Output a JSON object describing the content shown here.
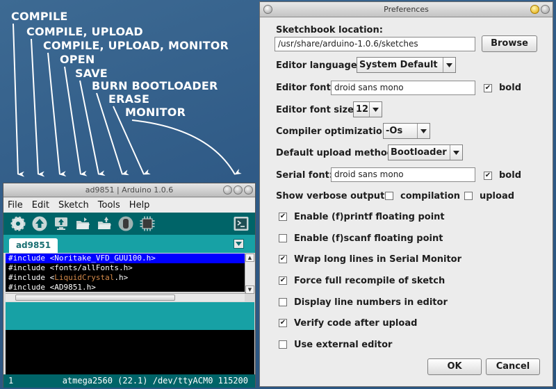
{
  "annotations": {
    "labels": [
      "COMPILE",
      "COMPILE, UPLOAD",
      "COMPILE, UPLOAD, MONITOR",
      "OPEN",
      "SAVE",
      "BURN BOOTLOADER",
      "ERASE",
      "MONITOR"
    ]
  },
  "arduino": {
    "title": "ad9851 | Arduino 1.0.6",
    "menu": [
      "File",
      "Edit",
      "Sketch",
      "Tools",
      "Help"
    ],
    "toolbar_icons": [
      "gear-icon",
      "upload-arrow-icon",
      "upload-monitor-icon",
      "open-folder-icon",
      "save-folder-icon",
      "burn-bootloader-icon",
      "chip-erase-icon"
    ],
    "serial_monitor_icon": "serial-monitor-icon",
    "tab_label": "ad9851",
    "code": {
      "line1": "#include <Noritake_VFD_GUU100.h>",
      "line2": "#include <fonts/allFonts.h>",
      "line3_prefix": "#include <",
      "line3_lib": "LiquidCrystal",
      "line3_suffix": ".h>",
      "line4": "#include <AD9851.h>"
    },
    "status": {
      "line": "1",
      "board": "atmega2560 (22.1) /dev/ttyACM0 115200"
    },
    "colors": {
      "toolbar": "#006468",
      "tabbar": "#17a1a5",
      "editor_bg": "#000000",
      "selection": "#0000ff"
    }
  },
  "preferences": {
    "title": "Preferences",
    "sketchbook_label": "Sketchbook location:",
    "sketchbook_path": "/usr/share/arduino-1.0.6/sketches",
    "browse_label": "Browse",
    "editor_language_label": "Editor language:",
    "editor_language_value": "System Default",
    "editor_font_label": "Editor font:",
    "editor_font_value": "droid sans mono",
    "editor_font_bold": {
      "label": "bold",
      "checked": true
    },
    "editor_font_size_label": "Editor font size:",
    "editor_font_size_value": "12",
    "compiler_opt_label": "Compiler optimization:",
    "compiler_opt_value": "-Os",
    "upload_method_label": "Default upload method:",
    "upload_method_value": "Bootloader",
    "serial_font_label": "Serial font:",
    "serial_font_value": "droid sans mono",
    "serial_font_bold": {
      "label": "bold",
      "checked": true
    },
    "verbose_label": "Show verbose output:",
    "verbose_compilation": {
      "label": "compilation",
      "checked": false
    },
    "verbose_upload": {
      "label": "upload",
      "checked": false
    },
    "options": [
      {
        "label": "Enable (f)printf floating point",
        "checked": true
      },
      {
        "label": "Enable (f)scanf floating point",
        "checked": false
      },
      {
        "label": "Wrap long lines in Serial Monitor",
        "checked": true
      },
      {
        "label": "Force full recompile of sketch",
        "checked": true
      },
      {
        "label": "Display line numbers in editor",
        "checked": false
      },
      {
        "label": "Verify code after upload",
        "checked": true
      },
      {
        "label": "Use external editor",
        "checked": false
      }
    ],
    "ok_label": "OK",
    "cancel_label": "Cancel"
  }
}
